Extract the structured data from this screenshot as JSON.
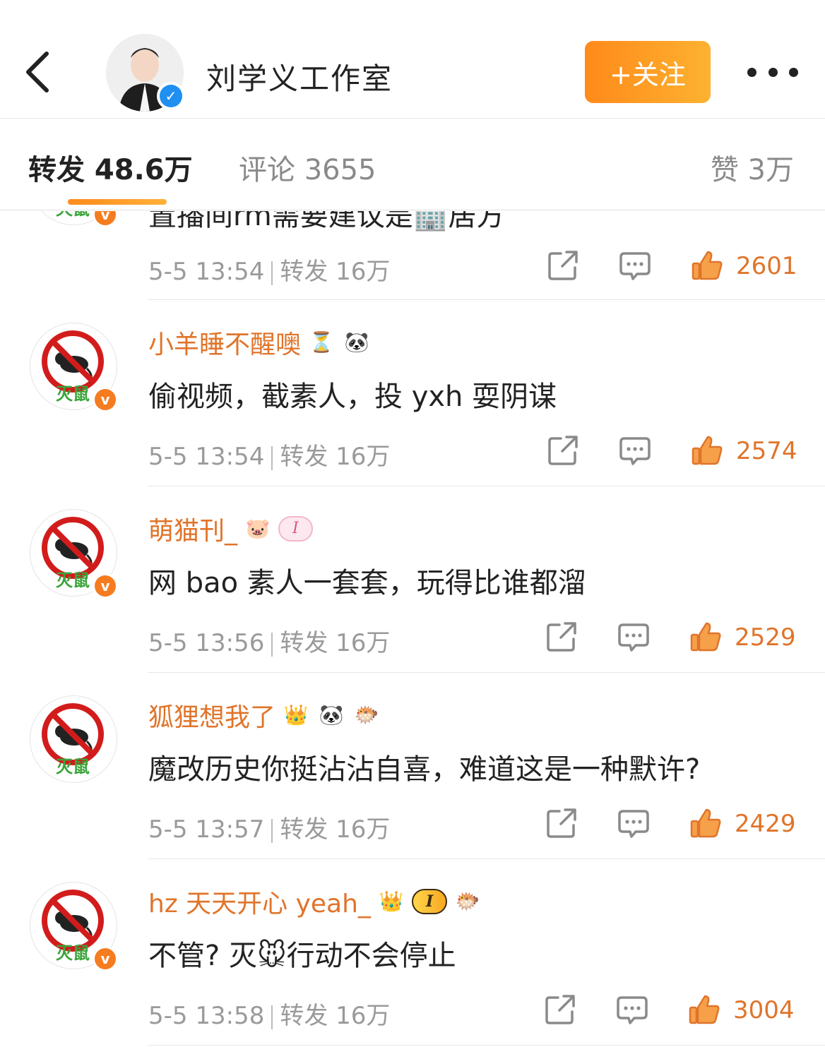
{
  "header": {
    "account_name": "刘学义工作室",
    "follow_label": "+关注",
    "verified_mark": "✓"
  },
  "tabs": {
    "repost": "转发 48.6万",
    "comment": "评论 3655",
    "like": "赞 3万"
  },
  "avatar_label": "灭鼠",
  "avatar_badge": "v",
  "partial_item": {
    "text": "置播间rm需要建议是🏢居方",
    "time": "5-5 13:54",
    "repost": "转发 16万",
    "likes": "2601"
  },
  "items": [
    {
      "username": "小羊睡不醒噢",
      "badges": [
        "⏳",
        "🐼"
      ],
      "text": "偷视频，截素人，投 yxh 耍阴谋",
      "time": "5-5 13:54",
      "repost": "转发 16万",
      "likes": "2574"
    },
    {
      "username": "萌猫刊_",
      "badges": [
        "🐷",
        "I"
      ],
      "text": "网 bao 素人一套套，玩得比谁都溜",
      "time": "5-5 13:56",
      "repost": "转发 16万",
      "likes": "2529"
    },
    {
      "username": "狐狸想我了",
      "badges": [
        "👑",
        "🐼",
        "🐡"
      ],
      "text": "魔改历史你挺沾沾自喜，难道这是一种默许?",
      "time": "5-5 13:57",
      "repost": "转发 16万",
      "likes": "2429"
    },
    {
      "username": "hz 天天开心 yeah_",
      "badges": [
        "👑",
        "I",
        "🐡"
      ],
      "text": "不管? 灭🐭行动不会停止",
      "time": "5-5 13:58",
      "repost": "转发 16万",
      "likes": "3004"
    }
  ]
}
